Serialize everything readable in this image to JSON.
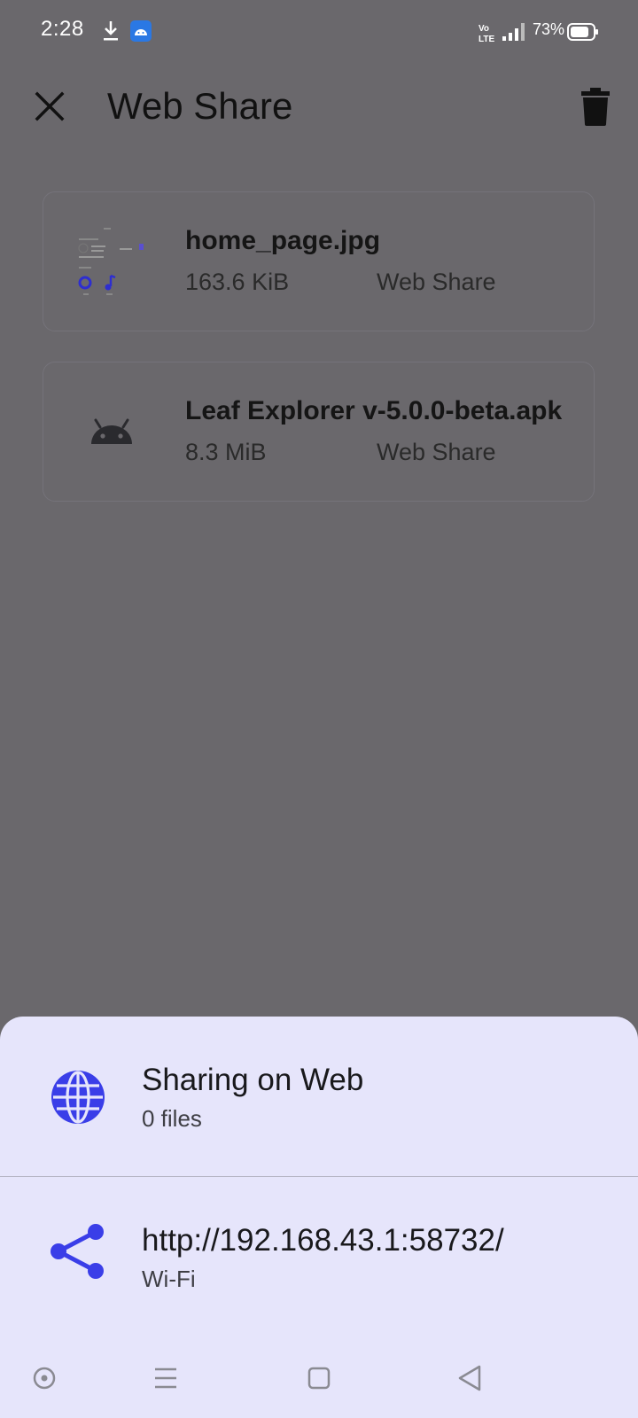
{
  "status_bar": {
    "time": "2:28",
    "network": "VoLTE",
    "battery_percent": "73%"
  },
  "toolbar": {
    "title": "Web Share",
    "close_icon": "close-icon",
    "delete_icon": "trash-icon"
  },
  "files": [
    {
      "name": "home_page.jpg",
      "size": "163.6 KiB",
      "source": "Web Share",
      "icon": "image-thumbnail"
    },
    {
      "name": "Leaf Explorer v-5.0.0-beta.apk",
      "size": "8.3 MiB",
      "source": "Web Share",
      "icon": "android-icon"
    }
  ],
  "sheet": {
    "sharing": {
      "title": "Sharing on Web",
      "subtitle": "0 files",
      "icon": "globe-icon"
    },
    "address": {
      "title": "http://192.168.43.1:58732/",
      "subtitle": "Wi-Fi",
      "icon": "share-icon"
    }
  },
  "colors": {
    "accent": "#3a3ee8",
    "sheet_background": "#e6e5fb",
    "scrim_background": "#6a686c"
  }
}
